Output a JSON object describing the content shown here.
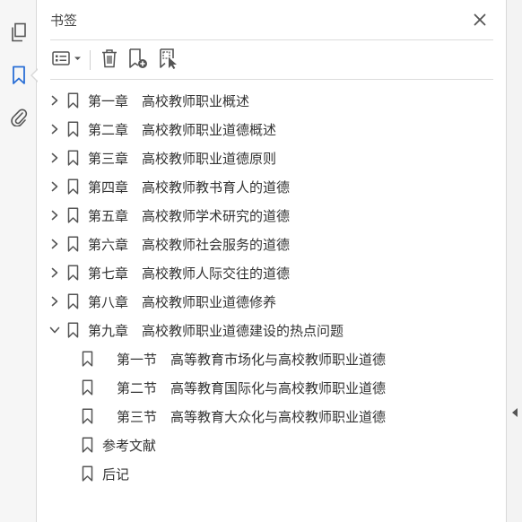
{
  "panel": {
    "title": "书签"
  },
  "rail": {
    "items": [
      {
        "icon": "pages-icon"
      },
      {
        "icon": "bookmark-icon",
        "active": true
      },
      {
        "icon": "attachment-icon"
      }
    ]
  },
  "toolbar": {
    "items": [
      {
        "icon": "options-menu-icon"
      },
      {
        "icon": "delete-icon"
      },
      {
        "icon": "new-bookmark-icon"
      },
      {
        "icon": "bookmark-from-selection-icon"
      }
    ]
  },
  "bookmarks": [
    {
      "label": "第一章　高校教师职业概述",
      "level": 0,
      "state": "collapsed"
    },
    {
      "label": "第二章　高校教师职业道德概述",
      "level": 0,
      "state": "collapsed"
    },
    {
      "label": "第三章　高校教师职业道德原则",
      "level": 0,
      "state": "collapsed"
    },
    {
      "label": "第四章　高校教师教书育人的道德",
      "level": 0,
      "state": "collapsed"
    },
    {
      "label": "第五章　高校教师学术研究的道德",
      "level": 0,
      "state": "collapsed"
    },
    {
      "label": "第六章　高校教师社会服务的道德",
      "level": 0,
      "state": "collapsed"
    },
    {
      "label": "第七章　高校教师人际交往的道德",
      "level": 0,
      "state": "collapsed"
    },
    {
      "label": "第八章　高校教师职业道德修养",
      "level": 0,
      "state": "collapsed"
    },
    {
      "label": "第九章　高校教师职业道德建设的热点问题",
      "level": 0,
      "state": "expanded"
    },
    {
      "label": "第一节　高等教育市场化与高校教师职业道德",
      "level": 1,
      "state": "leaf"
    },
    {
      "label": "第二节　高等教育国际化与高校教师职业道德",
      "level": 1,
      "state": "leaf"
    },
    {
      "label": "第三节　高等教育大众化与高校教师职业道德",
      "level": 1,
      "state": "leaf"
    },
    {
      "label": "参考文献",
      "level": 0,
      "state": "leaf"
    },
    {
      "label": "后记",
      "level": 0,
      "state": "leaf"
    }
  ],
  "colors": {
    "icon": "#555555",
    "active_icon": "#2a6fd6",
    "text": "#333333"
  }
}
